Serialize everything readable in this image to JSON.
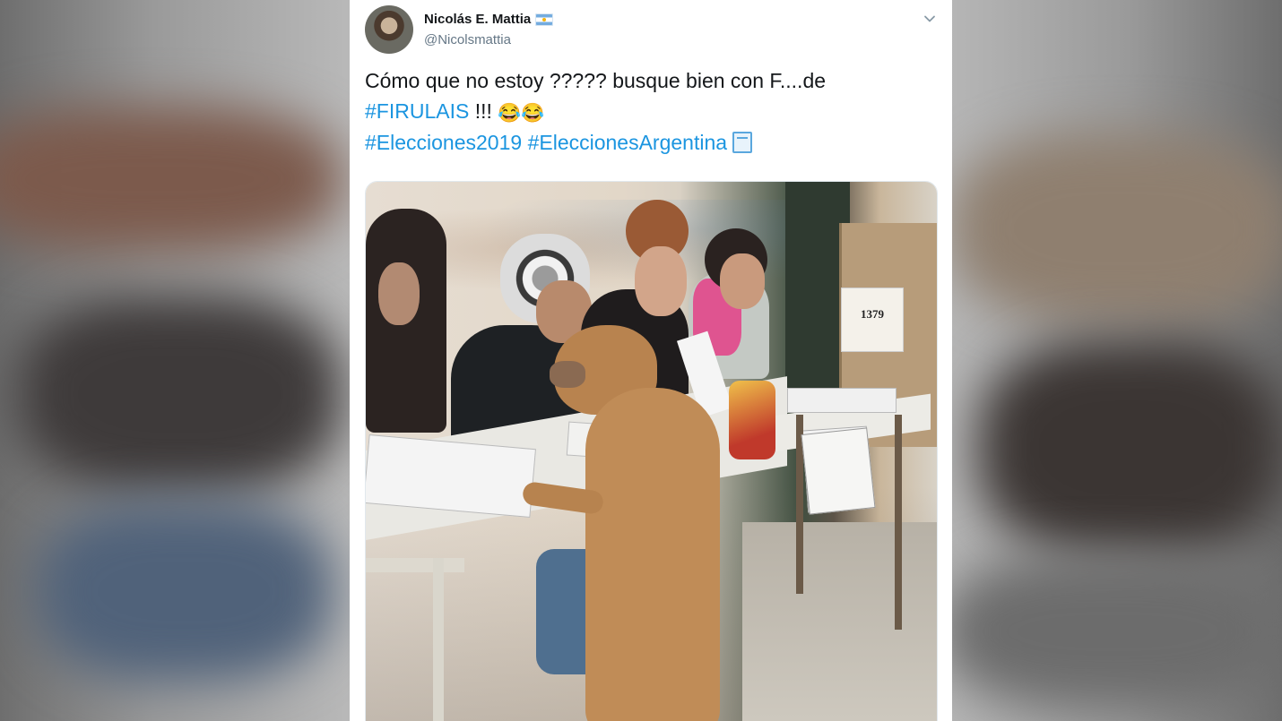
{
  "tweet": {
    "author": {
      "name": "Nicolás E. Mattia",
      "handle": "@Nicolsmattia",
      "flag_icon": "argentina-flag-icon"
    },
    "menu_icon": "chevron-down-icon",
    "text": {
      "line1": "Cómo que no estoy ????? busque bien con F....de",
      "hashtag_firulais": "#FIRULAIS",
      "exclaims": "!!!",
      "emoji": "😂😂",
      "hashtag_elecciones2019": "#Elecciones2019",
      "hashtag_elecciones_argentina": "#EleccionesArgentina",
      "ballot_icon": "ballot-box-icon"
    },
    "photo": {
      "box_number": "1379"
    },
    "colors": {
      "link": "#1b95e0",
      "text": "#14171a",
      "secondary": "#657786"
    }
  }
}
